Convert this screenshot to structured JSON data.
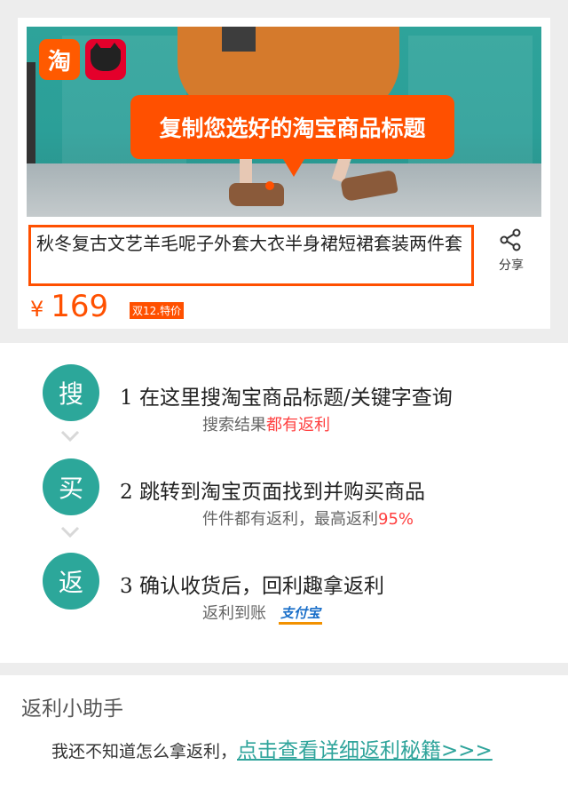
{
  "product": {
    "tooltip": "复制您选好的淘宝商品标题",
    "title": "秋冬复古文艺羊毛呢子外套大衣半身裙短裙套装两件套",
    "share_label": "分享",
    "currency": "¥",
    "price": "169",
    "badge": "双12.特价",
    "taobao_icon_char": "淘"
  },
  "steps": [
    {
      "icon": "搜",
      "title": "1 在这里搜淘宝商品标题/关键字查询",
      "sub": "搜索结果",
      "sub_highlight": "都有返利"
    },
    {
      "icon": "买",
      "title": "2 跳转到淘宝页面找到并购买商品",
      "sub": "件件都有返利，最高返利",
      "sub_highlight": "95%"
    },
    {
      "icon": "返",
      "title": "3 确认收货后，回利趣拿返利",
      "sub": "返利到账",
      "brand": "支付宝"
    }
  ],
  "helper": {
    "title": "返利小助手",
    "text": "我还不知道怎么拿返利，",
    "link": "点击查看详细返利秘籍>>>"
  },
  "colors": {
    "accent": "#ff5000",
    "teal": "#2ca79a",
    "highlight": "#ff4040"
  }
}
